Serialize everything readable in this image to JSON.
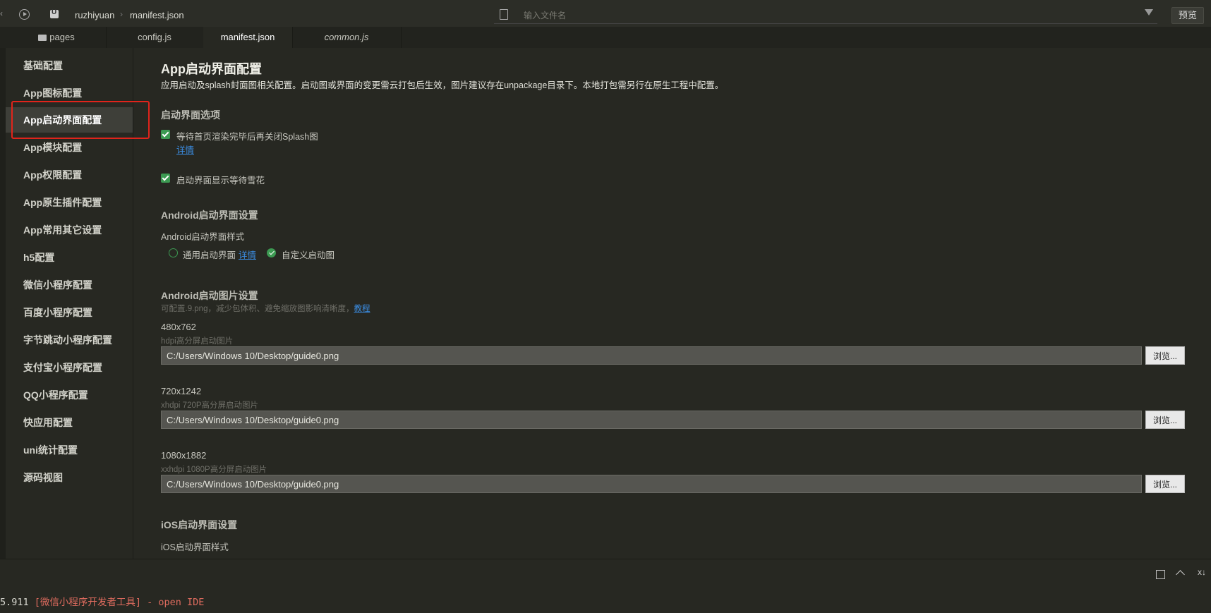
{
  "topbar": {
    "breadcrumb": [
      "ruzhiyuan",
      "manifest.json"
    ],
    "search_placeholder": "输入文件名",
    "preview_label": "预览"
  },
  "tabs": [
    {
      "label": "pages",
      "icon": "folder-icon"
    },
    {
      "label": "config.js"
    },
    {
      "label": "manifest.json",
      "active": true
    },
    {
      "label": "common.js",
      "italic": true
    }
  ],
  "nav": {
    "items": [
      "基础配置",
      "App图标配置",
      "App启动界面配置",
      "App模块配置",
      "App权限配置",
      "App原生插件配置",
      "App常用其它设置",
      "h5配置",
      "微信小程序配置",
      "百度小程序配置",
      "字节跳动小程序配置",
      "支付宝小程序配置",
      "QQ小程序配置",
      "快应用配置",
      "uni统计配置",
      "源码视图"
    ],
    "active_index": 2
  },
  "main": {
    "title": "App启动界面配置",
    "description": "应用启动及splash封面图相关配置。启动图或界面的变更需云打包后生效，图片建议存在unpackage目录下。本地打包需另行在原生工程中配置。",
    "splash_section": {
      "heading": "启动界面选项",
      "wait_render_label": "等待首页渲染完毕后再关闭Splash图",
      "details_link": "详情",
      "show_snow_label": "启动界面显示等待雪花"
    },
    "android_splash": {
      "heading": "Android启动界面设置",
      "style_label": "Android启动界面样式",
      "option_common": "通用启动界面",
      "option_common_link": "详情",
      "option_custom": "自定义启动图"
    },
    "android_images": {
      "heading": "Android启动图片设置",
      "hint": "可配置.9.png，减少包体积、避免缩放图影响清晰度，",
      "hint_link": "教程",
      "browse_label": "浏览...",
      "items": [
        {
          "size": "480x762",
          "desc": "hdpi高分屏启动图片",
          "path": "C:/Users/Windows 10/Desktop/guide0.png"
        },
        {
          "size": "720x1242",
          "desc": "xhdpi 720P高分屏启动图片",
          "path": "C:/Users/Windows 10/Desktop/guide0.png"
        },
        {
          "size": "1080x1882",
          "desc": "xxhdpi 1080P高分屏启动图片",
          "path": "C:/Users/Windows 10/Desktop/guide0.png"
        }
      ]
    },
    "ios_splash": {
      "heading": "iOS启动界面设置",
      "style_label": "iOS启动界面样式"
    }
  },
  "console": {
    "time": "5.911",
    "message": " [微信小程序开发者工具] - open IDE"
  },
  "colors": {
    "background": "#272822",
    "accent_green": "#3c9a52",
    "link_blue": "#3b8ee5",
    "highlight_red": "#e0241b"
  }
}
